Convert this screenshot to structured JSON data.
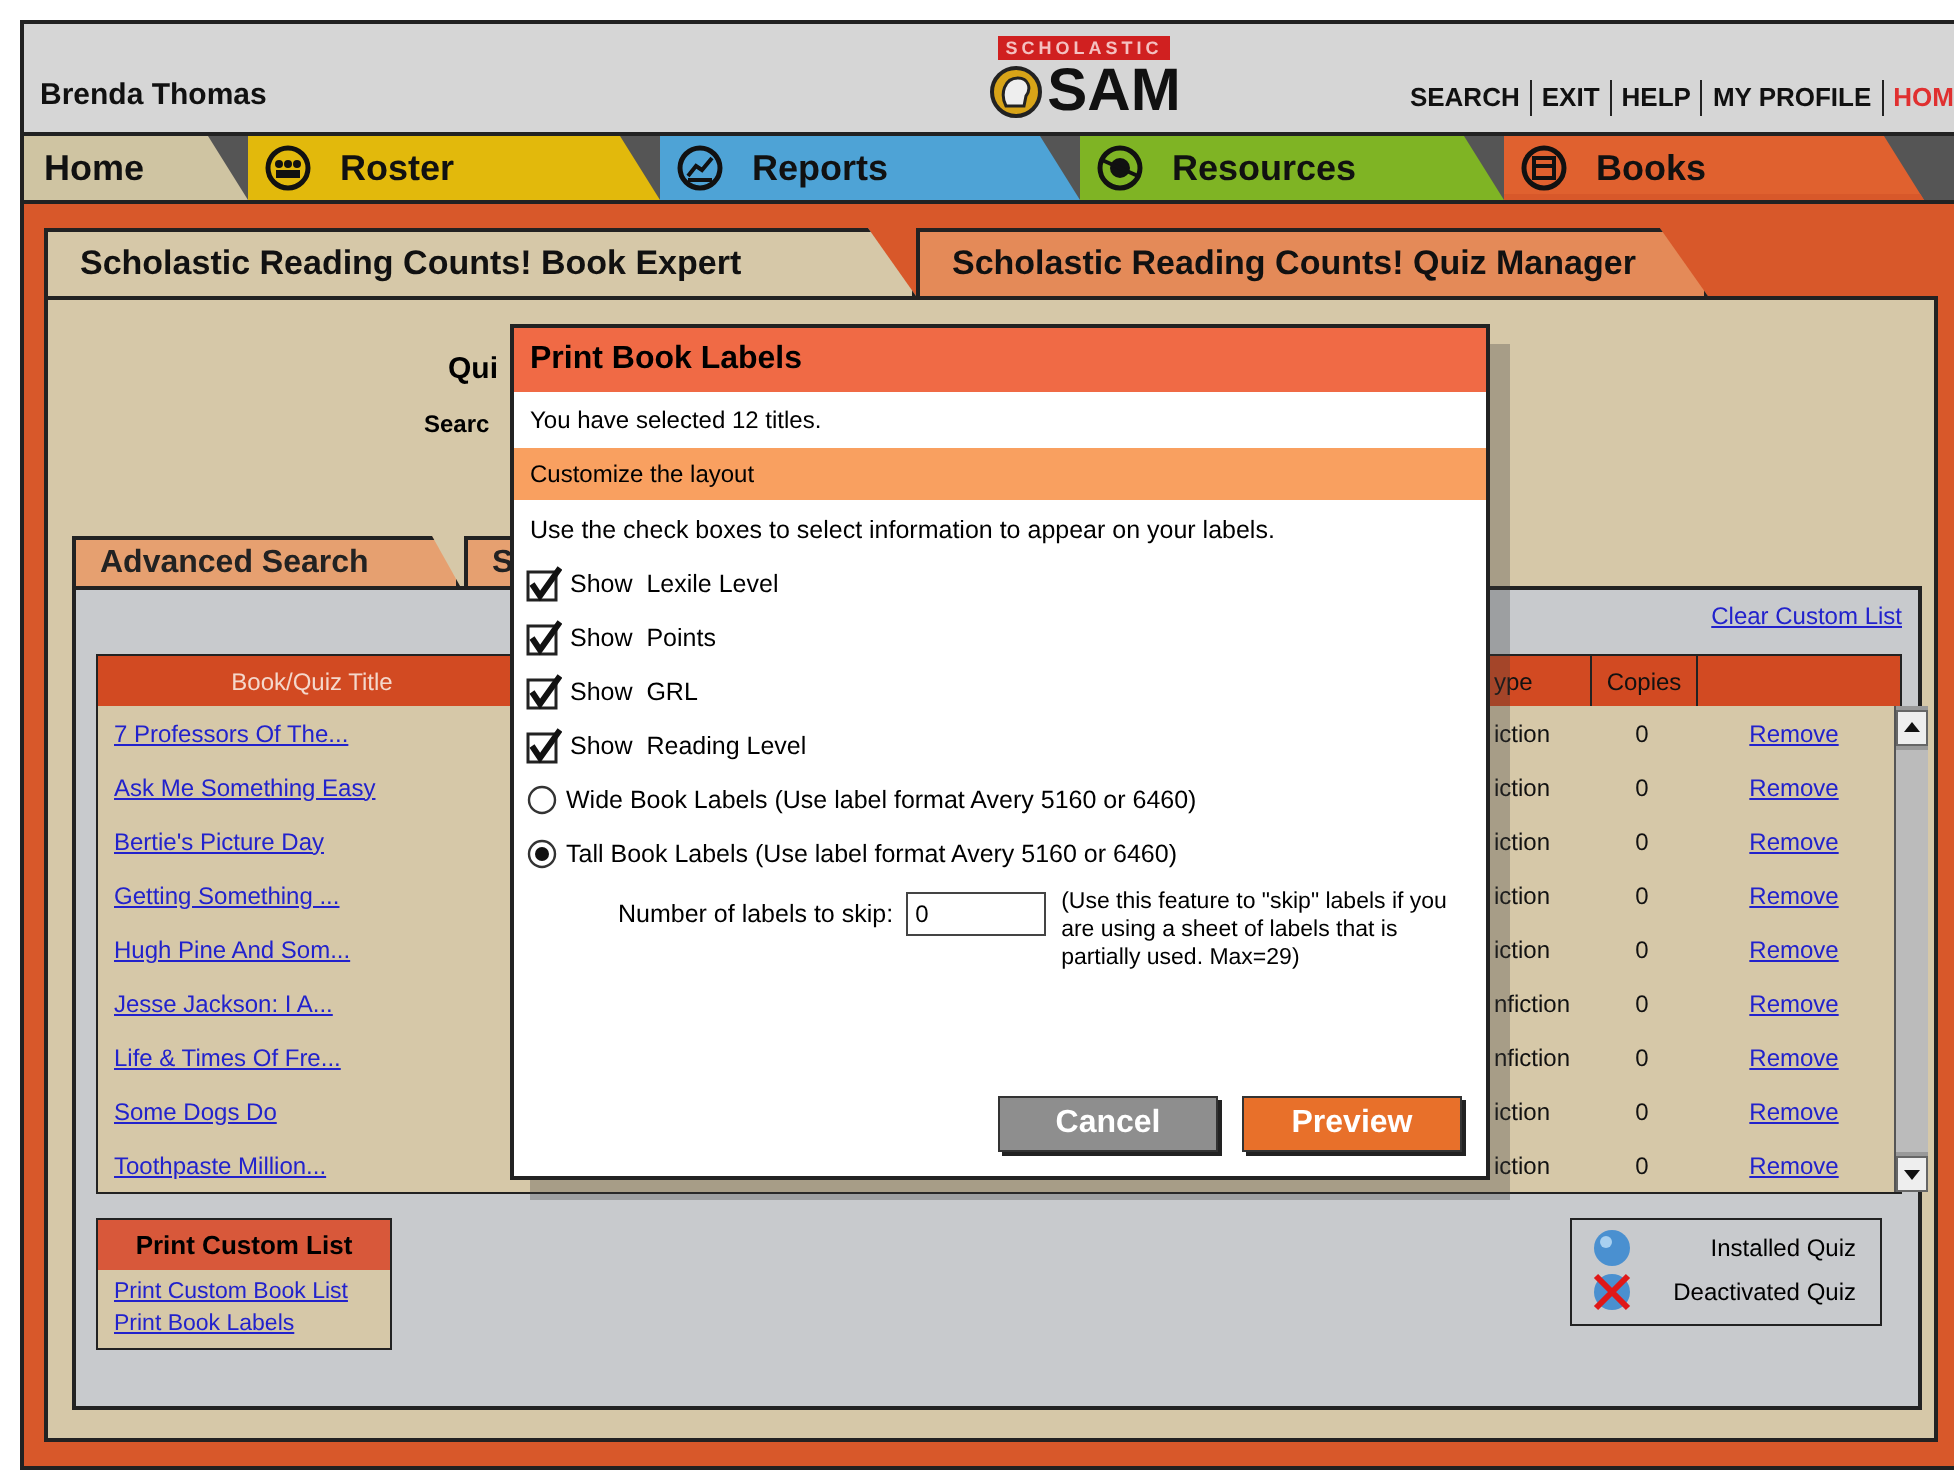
{
  "user": {
    "name": "Brenda Thomas"
  },
  "logo": {
    "badge": "SCHOLASTIC",
    "text": "SAM"
  },
  "top_links": [
    {
      "label": "SEARCH",
      "kind": "plain"
    },
    {
      "label": "EXIT",
      "kind": "plain"
    },
    {
      "label": "HELP",
      "kind": "plain"
    },
    {
      "label": "MY PROFILE",
      "kind": "plain"
    },
    {
      "label": "HOM",
      "kind": "home"
    }
  ],
  "tabs": [
    {
      "label": "Home",
      "color": "#cfc4a2",
      "selected": false
    },
    {
      "label": "Roster",
      "color": "#e2b90c",
      "selected": false
    },
    {
      "label": "Reports",
      "color": "#4ea3d6",
      "selected": false
    },
    {
      "label": "Resources",
      "color": "#7fb424",
      "selected": false
    },
    {
      "label": "Books",
      "color": "#e0612f",
      "selected": true
    }
  ],
  "sub_tabs": [
    {
      "label": "Scholastic Reading Counts! Book Expert",
      "selected": true
    },
    {
      "label": "Scholastic Reading Counts! Quiz Manager",
      "selected": false
    }
  ],
  "search_area": {
    "label_1": "Qui",
    "label_2": "Searc"
  },
  "search_tabs": [
    {
      "label": "Advanced Search",
      "selected": true
    },
    {
      "label": "S",
      "selected": false
    }
  ],
  "clear_link": "Clear Custom List",
  "table": {
    "columns": [
      "Book/Quiz Title",
      "ype",
      "Copies"
    ],
    "rows": [
      {
        "title": "7 Professors Of The...",
        "type": "iction",
        "copies": "0",
        "action": "Remove"
      },
      {
        "title": "Ask Me Something Easy",
        "type": "iction",
        "copies": "0",
        "action": "Remove"
      },
      {
        "title": "Bertie's Picture Day",
        "type": "iction",
        "copies": "0",
        "action": "Remove"
      },
      {
        "title": "Getting Something ...",
        "type": "iction",
        "copies": "0",
        "action": "Remove"
      },
      {
        "title": "Hugh Pine And Som...",
        "type": "iction",
        "copies": "0",
        "action": "Remove"
      },
      {
        "title": "Jesse Jackson: I A...",
        "type": "nfiction",
        "copies": "0",
        "action": "Remove"
      },
      {
        "title": "Life & Times Of Fre...",
        "type": "nfiction",
        "copies": "0",
        "action": "Remove"
      },
      {
        "title": "Some Dogs Do",
        "type": "iction",
        "copies": "0",
        "action": "Remove"
      },
      {
        "title": "Toothpaste Million...",
        "type": "iction",
        "copies": "0",
        "action": "Remove"
      }
    ]
  },
  "print_box": {
    "title": "Print Custom List",
    "links": [
      "Print Custom Book List",
      "Print Book Labels"
    ]
  },
  "legend": [
    {
      "label": "Installed Quiz",
      "kind": "installed"
    },
    {
      "label": "Deactivated Quiz",
      "kind": "deactivated"
    }
  ],
  "dialog": {
    "title": "Print Book Labels",
    "selected_text": "You have selected 12 titles.",
    "section": "Customize the layout",
    "instruction": "Use the check boxes to select information to appear on your labels.",
    "checkboxes": [
      {
        "label": "Show  Lexile Level",
        "checked": true
      },
      {
        "label": "Show  Points",
        "checked": true
      },
      {
        "label": "Show  GRL",
        "checked": true
      },
      {
        "label": "Show  Reading Level",
        "checked": true
      }
    ],
    "radios": [
      {
        "label": "Wide Book Labels (Use label format Avery 5160 or 6460)",
        "selected": false
      },
      {
        "label": "Tall Book Labels (Use label format Avery 5160 or 6460)",
        "selected": true
      }
    ],
    "skip": {
      "label": "Number of labels to skip:",
      "value": "0",
      "note": "(Use this feature to \"skip\" labels if you are using a sheet of labels that is partially used. Max=29)"
    },
    "buttons": [
      {
        "label": "Cancel",
        "kind": "secondary"
      },
      {
        "label": "Preview",
        "kind": "primary"
      }
    ]
  }
}
